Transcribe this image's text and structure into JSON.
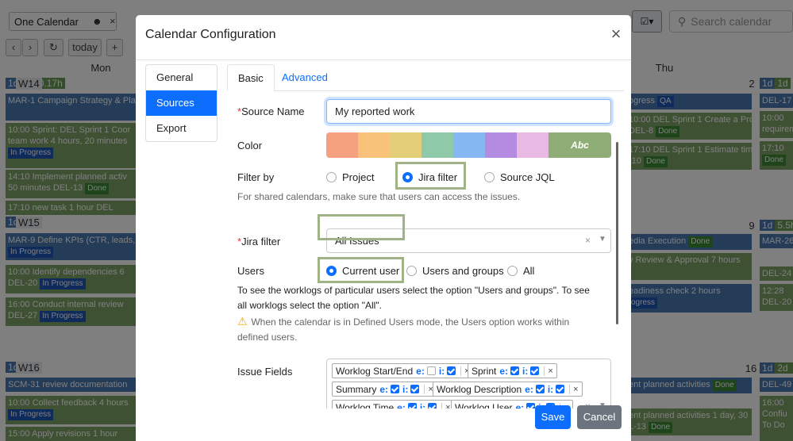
{
  "background": {
    "calendar_select": "One Calendar",
    "search_placeholder": "Search calendar",
    "today_label": "today",
    "days": [
      "Mon",
      "Thu"
    ],
    "weeks": [
      {
        "label": "W14",
        "a": "1d",
        "b": "1d",
        "c": "0.17h"
      },
      {
        "label": "W15",
        "a": "1d",
        "b": "1d"
      },
      {
        "label": "W16",
        "a": "1d",
        "b": "5h"
      }
    ],
    "day_numbers": [
      "2",
      "9",
      "16"
    ],
    "right_col": [
      {
        "a": "1d",
        "b": "1d"
      },
      {
        "a": "1d",
        "b": "5.5h"
      },
      {
        "a": "1d",
        "b": "2d",
        "c": "0"
      }
    ],
    "events": [
      "MAR-1 Campaign Strategy & Plan",
      "10:00 Sprint: DEL Sprint 1 Coor",
      "team work 4 hours, 20 minutes",
      "In Progress",
      "14:10 Implement planned activ",
      "50 minutes",
      "DEL-13",
      "Done",
      "17:10 new task 1 hour",
      "DEL",
      "MAR-9 Define KPIs (CTR, leads, im",
      "In Progress",
      "10:00 Identify dependencies 6",
      "DEL-20",
      "In Progress",
      "16:00 Conduct internal review",
      "DEL-27",
      "In Progress",
      "SCM-31 review documentation",
      "10:00 Collect feedback 4 hours",
      "In Progress",
      "15:00 Apply revisions 1 hour",
      "ogress",
      "QA",
      "10:00 DEL Sprint 1 Create a Project",
      "DEL-8",
      "Done",
      "17:10 DEL Sprint 1 Estimate timelines",
      "-10",
      "Done",
      "edia Execution",
      "Done",
      "y Review & Approval 7 hours",
      "eadiness check 2 hours",
      "ogress",
      "ent planned activities",
      "Done",
      "ent planned activities 1 day, 30",
      "L-13",
      "Done",
      "DEL-17",
      "10:00",
      "requirem",
      "17:10",
      "Done",
      "MAR-26",
      "DEL-24",
      "12:28",
      "DEL-20",
      "DEL-49",
      "16:00",
      "Confiu",
      "To Do"
    ]
  },
  "modal": {
    "title": "Calendar Configuration",
    "sidenav": [
      "General",
      "Sources",
      "Export"
    ],
    "active_sidenav": 1,
    "tabs": [
      "Basic",
      "Advanced"
    ],
    "source_name_label": "Source Name",
    "source_name_value": "My reported work",
    "color_label": "Color",
    "swatch_colors": [
      "#f5a07e",
      "#f9c27b",
      "#e4cf78",
      "#8ec9a9",
      "#85b7f2",
      "#b38be0",
      "#e8b9e2",
      "#8fae76"
    ],
    "swatch_abc": "Abc",
    "filter_label": "Filter by",
    "filter_options": [
      "Project",
      "Jira filter",
      "Source JQL"
    ],
    "filter_selected": "Jira filter",
    "filter_help": "For shared calendars, make sure that users can access the issues.",
    "jira_filter_label": "Jira filter",
    "jira_filter_value": "All Issues",
    "users_label": "Users",
    "users_options": [
      "Current user",
      "Users and groups",
      "All"
    ],
    "users_selected": "Current user",
    "users_help_line1": "To see the worklogs of particular users select the option \"Users and groups\". To see",
    "users_help_line2": "all worklogs select the option \"All\".",
    "warning_line1": "When the calendar is in Defined Users mode, the Users option works within",
    "warning_line2": "defined users.",
    "issue_fields_label": "Issue Fields",
    "issue_fields": [
      {
        "name": "Worklog Start/End",
        "e": false,
        "i": true
      },
      {
        "name": "Sprint",
        "e": true,
        "i": true
      },
      {
        "name": "Summary",
        "e": true,
        "i": true
      },
      {
        "name": "Worklog Description",
        "e": true,
        "i": true
      },
      {
        "name": "Worklog Time",
        "e": true,
        "i": true
      },
      {
        "name": "Worklog User",
        "e": true,
        "i": true
      }
    ],
    "e_label": "e:",
    "i_label": "i:",
    "save_label": "Save",
    "cancel_label": "Cancel"
  }
}
